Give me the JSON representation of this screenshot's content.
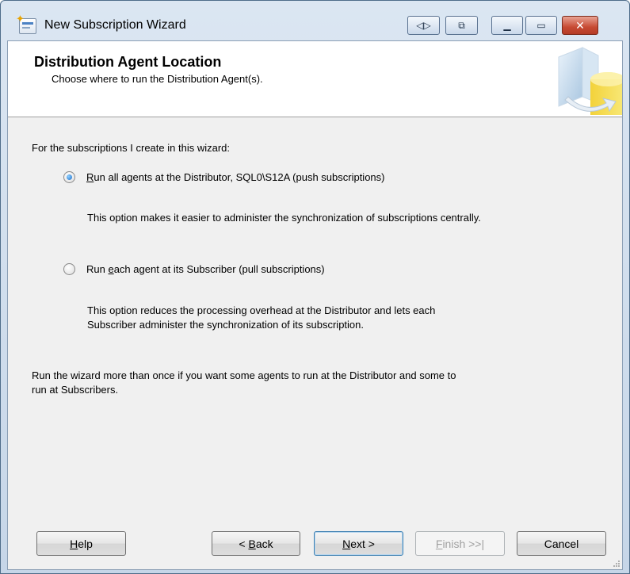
{
  "window": {
    "title": "New Subscription Wizard"
  },
  "header": {
    "title": "Distribution Agent Location",
    "subtitle": "Choose where to run the Distribution Agent(s)."
  },
  "content": {
    "intro": "For the subscriptions I create in this wizard:",
    "option_push": {
      "pre": "",
      "accel": "R",
      "post": "un all agents at the Distributor, SQL0\\S12A (push subscriptions)",
      "checked": true,
      "description": "This option makes it easier to administer the synchronization of subscriptions centrally."
    },
    "option_pull": {
      "pre": "Run ",
      "accel": "e",
      "post": "ach agent at its Subscriber (pull subscriptions)",
      "checked": false,
      "description_line1": "This option reduces the processing overhead at the Distributor and lets each",
      "description_line2": "Subscriber administer the synchronization of its subscription."
    },
    "footer_line1": "Run the wizard more than once if you want some agents to run at the Distributor and some to",
    "footer_line2": "run at Subscribers."
  },
  "buttons": {
    "help": {
      "accel": "H",
      "rest": "elp"
    },
    "back": {
      "pre": "< ",
      "accel": "B",
      "rest": "ack"
    },
    "next": {
      "accel": "N",
      "rest": "ext >"
    },
    "finish": {
      "accel": "F",
      "rest": "inish >>|"
    },
    "cancel": {
      "label": "Cancel"
    }
  },
  "colors": {
    "accent": "#3c7fb1",
    "close_button": "#c74a33",
    "client_background": "#f0f0f0"
  }
}
